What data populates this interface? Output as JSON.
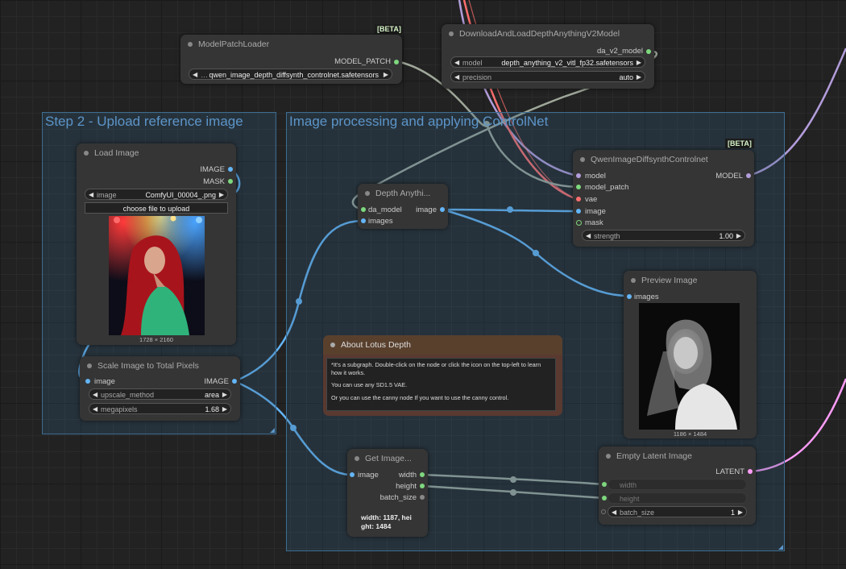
{
  "groups": {
    "upload": {
      "title": "Step 2 - Upload reference image"
    },
    "processing": {
      "title": "Image processing and applying ControlNet"
    }
  },
  "nodes": {
    "model_patch_loader": {
      "title": "ModelPatchLoader",
      "badge": "[BETA]",
      "output": "MODEL_PATCH",
      "widget_value": "qwen_image_depth_diffsynth_controlnet.safetensors"
    },
    "download_depth": {
      "title": "DownloadAndLoadDepthAnythingV2Model",
      "output": "da_v2_model",
      "widgets": [
        {
          "label": "model",
          "value": "depth_anything_v2_vitl_fp32.safetensors"
        },
        {
          "label": "precision",
          "value": "auto"
        }
      ]
    },
    "qwen_controlnet": {
      "title": "QwenImageDiffsynthControlnet",
      "badge": "[BETA]",
      "inputs": [
        "model",
        "model_patch",
        "vae",
        "image",
        "mask"
      ],
      "output": "MODEL",
      "widget": {
        "label": "strength",
        "value": "1.00"
      }
    },
    "load_image": {
      "title": "Load Image",
      "outputs": [
        "IMAGE",
        "MASK"
      ],
      "widget": {
        "label": "image",
        "value": "ComfyUI_00004_.png"
      },
      "upload_button": "choose file to upload",
      "dimensions": "1728 × 2160"
    },
    "scale_image": {
      "title": "Scale Image to Total Pixels",
      "input": "image",
      "output": "IMAGE",
      "widgets": [
        {
          "label": "upscale_method",
          "value": "area"
        },
        {
          "label": "megapixels",
          "value": "1.68"
        }
      ]
    },
    "depth_anything": {
      "title": "Depth Anythi...",
      "inputs": [
        "da_model",
        "images"
      ],
      "output": "image"
    },
    "preview_image": {
      "title": "Preview Image",
      "input": "images",
      "dimensions": "1186 × 1484"
    },
    "about_note": {
      "title": "About Lotus Depth",
      "lines": [
        "*It's a subgraph. Double-click on the node or click the icon on the top-left to learn how it works.",
        "You can use any SD1.5 VAE.",
        "Or you can use the canny node If you want to use the canny control."
      ]
    },
    "get_image": {
      "title": "Get Image...",
      "input": "image",
      "outputs": [
        "width",
        "height",
        "batch_size"
      ],
      "info": "width: 1187, height: 1484"
    },
    "empty_latent": {
      "title": "Empty Latent Image",
      "output": "LATENT",
      "widgets": [
        {
          "label": "width"
        },
        {
          "label": "height"
        },
        {
          "label": "batch_size",
          "value": "1"
        }
      ]
    }
  },
  "colors": {
    "image_link": "#64b5f6",
    "model_link": "#b39ddb",
    "vae_link": "#ff6e6e",
    "latent_link": "#ff9cf9",
    "int_link": "#9fa89a",
    "green_slot": "#7ed87e",
    "group_border": "#3c6d92"
  }
}
